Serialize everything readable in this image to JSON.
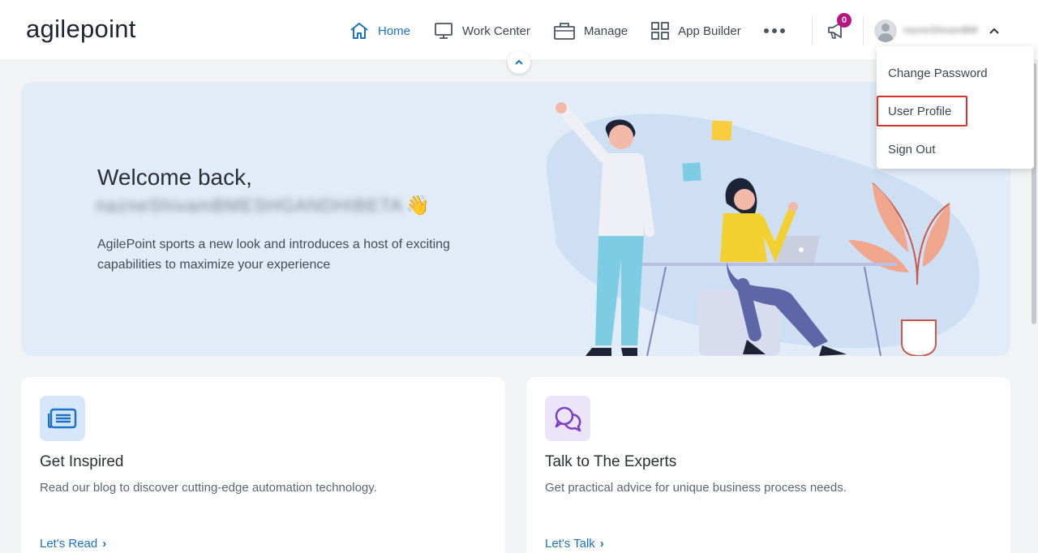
{
  "header": {
    "logo_text": "agilepoint",
    "nav": [
      {
        "label": "Home",
        "icon": "home-icon",
        "active": true
      },
      {
        "label": "Work Center",
        "icon": "monitor-icon",
        "active": false
      },
      {
        "label": "Manage",
        "icon": "briefcase-icon",
        "active": false
      },
      {
        "label": "App Builder",
        "icon": "grid-icon",
        "active": false
      }
    ],
    "more_icon": "more-dots-icon",
    "notification_count": "0",
    "user_name": "nazneShivamBMENHG"
  },
  "user_menu": {
    "items": [
      "Change Password",
      "User Profile",
      "Sign Out"
    ],
    "highlighted": "User Profile"
  },
  "banner": {
    "greeting": "Welcome back,",
    "user_display_name": "nazneShivamBMESHGANDHIBETA",
    "wave_emoji": "👋",
    "intro": "AgilePoint sports a new look and introduces a host of exciting capabilities to maximize your experience"
  },
  "cards": [
    {
      "title": "Get Inspired",
      "description": "Read our blog to discover cutting-edge automation technology.",
      "link": "Let's Read",
      "icon": "newspaper-icon"
    },
    {
      "title": "Talk to The Experts",
      "description": "Get practical advice for unique business process needs.",
      "link": "Let's Talk",
      "icon": "chat-bubbles-icon"
    }
  ],
  "colors": {
    "accent": "#1a73c7",
    "badge": "#b8167f",
    "banner_bg": "#e1ecf8",
    "highlight_border": "#d9342b",
    "card1_icon_bg": "#d6e7fa",
    "card2_icon_bg": "#ece4f8"
  }
}
